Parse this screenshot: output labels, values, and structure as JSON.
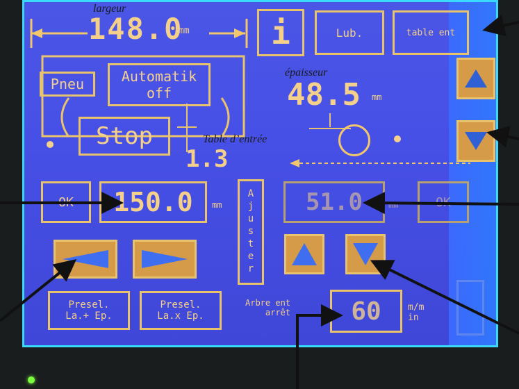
{
  "overlay_labels": {
    "width": "largeur",
    "thickness": "épaisseur",
    "entry_table": "Table d’entrée"
  },
  "top_bar": {
    "width_value": "148.0",
    "width_unit": "mm",
    "info_button": "i",
    "lub_button": "Lub.",
    "table_button": "table ent"
  },
  "left_panel": {
    "pneu_button": "Pneu",
    "automatik_line1": "Automatik",
    "automatik_line2": "off",
    "stop_button": "Stop",
    "entry_value": "1.3"
  },
  "thickness": {
    "value": "48.5",
    "unit": "mm"
  },
  "row_mid": {
    "ok_left": "OK",
    "setpoint_value": "150.0",
    "setpoint_unit": "mm",
    "ajuster_vertical": "Ajuster",
    "readout_value": "51.0",
    "readout_unit": "mm",
    "ok_right": "OK"
  },
  "bottom": {
    "presel_add_line1": "Presel.",
    "presel_add_line2": "La.+ Ep.",
    "presel_mul_line1": "Presel.",
    "presel_mul_line2": "La.x Ep.",
    "arbre_line1": "Arbre ent",
    "arbre_line2": "arrêt",
    "speed_value": "60",
    "speed_unit_line1": "m/m",
    "speed_unit_line2": "in"
  },
  "colors": {
    "screen": "#4750e6",
    "accent": "#f2c66a",
    "frame": "#3bd9ff"
  }
}
